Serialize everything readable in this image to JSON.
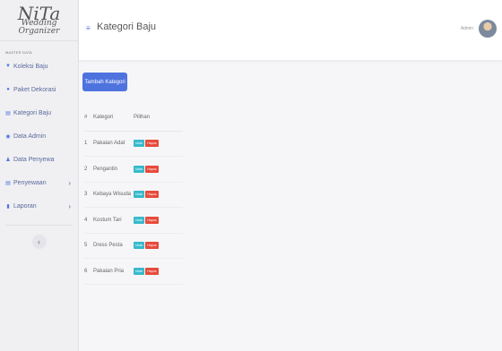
{
  "brand": {
    "logo_main": "NiTa",
    "logo_sub": "Wedding Organizer"
  },
  "sidebar": {
    "section_label": "MASTER DATA",
    "items": [
      {
        "label": "Koleksi Baju",
        "icon": "shirt-icon",
        "glyph": "▼"
      },
      {
        "label": "Paket Dekorasi",
        "icon": "flower-icon",
        "glyph": "●"
      },
      {
        "label": "Kategori Baju",
        "icon": "list-icon",
        "glyph": "▤"
      },
      {
        "label": "Data Admin",
        "icon": "admin-icon",
        "glyph": "◉"
      },
      {
        "label": "Data Penyewa",
        "icon": "user-icon",
        "glyph": "♟"
      },
      {
        "label": "Penyewaan",
        "icon": "rental-icon",
        "glyph": "▤",
        "chevron": "›"
      },
      {
        "label": "Laporan",
        "icon": "report-icon",
        "glyph": "▮",
        "chevron": "›"
      }
    ],
    "collapse_glyph": "‹"
  },
  "topbar": {
    "hamburger": "≡",
    "title": "Kategori Baju",
    "user_name": "Admin"
  },
  "main": {
    "add_button": "Tambah Kategori",
    "table": {
      "headers": [
        "#",
        "Kategori",
        "Pilihan"
      ],
      "action_labels": {
        "edit": "Ubah",
        "delete": "Hapus"
      },
      "rows": [
        {
          "no": "1",
          "kategori": "Pakaian Adat"
        },
        {
          "no": "2",
          "kategori": "Pengantin"
        },
        {
          "no": "3",
          "kategori": "Kebaya Wisuda"
        },
        {
          "no": "4",
          "kategori": "Kostum Tari"
        },
        {
          "no": "5",
          "kategori": "Dress Pesta"
        },
        {
          "no": "6",
          "kategori": "Pakaian Pria"
        }
      ]
    }
  },
  "colors": {
    "primary": "#4e73df",
    "info": "#36b9cc",
    "danger": "#e74a3b"
  }
}
